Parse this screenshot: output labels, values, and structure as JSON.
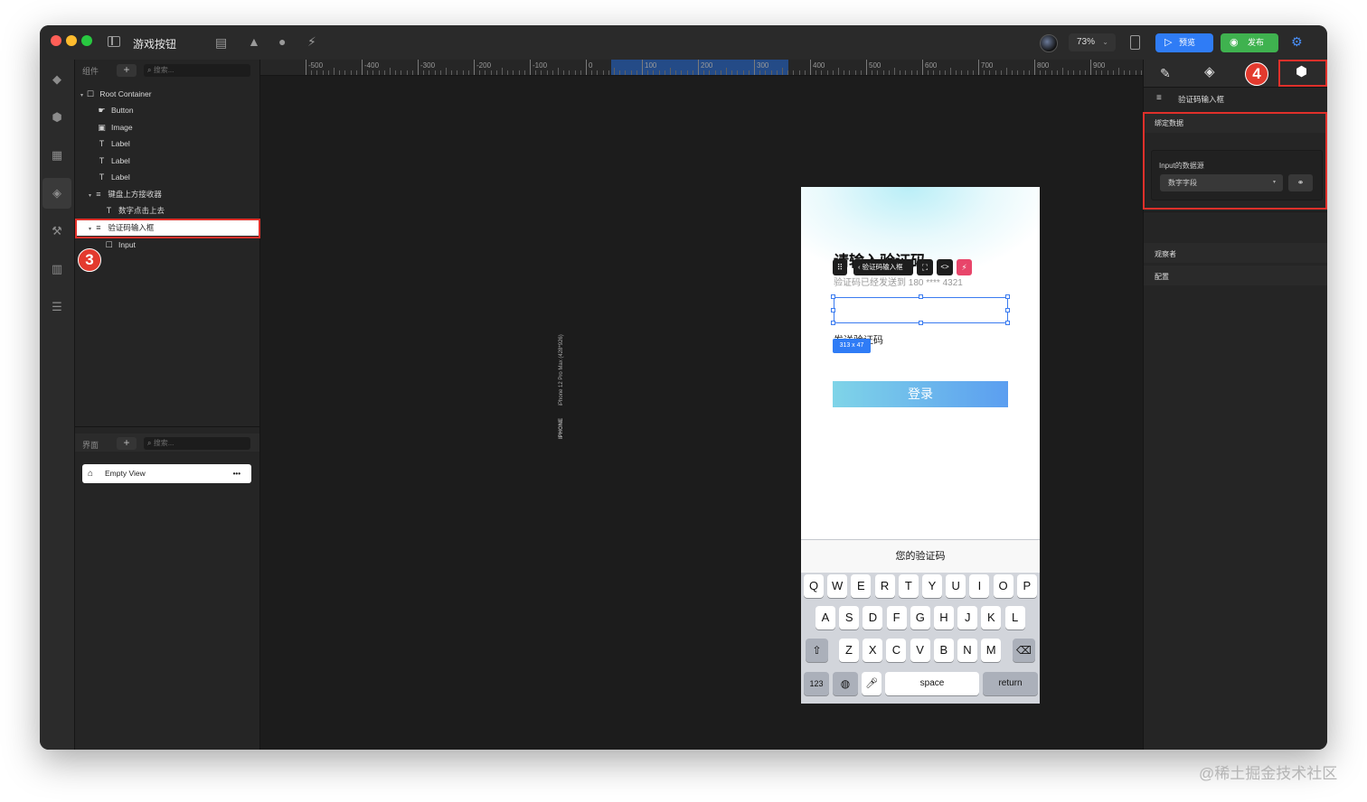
{
  "window": {
    "title": "游戏按钮",
    "zoom": "73%",
    "preview_label": "预览",
    "publish_label": "发布"
  },
  "components_panel": {
    "title": "组件",
    "search_placeholder": "搜索...",
    "tree": [
      {
        "label": "Root Container",
        "icon": "square-icon"
      },
      {
        "label": "Button",
        "icon": "hand-pointer-icon"
      },
      {
        "label": "Image",
        "icon": "image-icon"
      },
      {
        "label": "Label",
        "icon": "text-icon"
      },
      {
        "label": "Label",
        "icon": "text-icon"
      },
      {
        "label": "Label",
        "icon": "text-icon"
      },
      {
        "label": "键盘上方接收器",
        "icon": "database-icon"
      },
      {
        "label": "数字点击上去",
        "icon": "text-icon"
      },
      {
        "label": "验证码输入框",
        "icon": "database-icon"
      },
      {
        "label": "Input",
        "icon": "square-icon"
      }
    ]
  },
  "screens_panel": {
    "title": "界面",
    "search_placeholder": "搜索...",
    "items": [
      {
        "label": "Empty View",
        "more": "•••"
      }
    ]
  },
  "ruler": {
    "ticks": [
      "-500",
      "-400",
      "-300",
      "-200",
      "-100",
      "0",
      "100",
      "200",
      "300",
      "400",
      "500",
      "600",
      "700",
      "800",
      "900"
    ]
  },
  "device_label": {
    "name": "IPHONE",
    "model": "iPhone 12 Pro Max (428*926)"
  },
  "phone": {
    "title": "请输入验证码",
    "subtitle": "验证码已经发送到 180 **** 4321",
    "send_code": "发送验证码",
    "size_badge": "313 x 47",
    "toolbar_label": "验证码输入框",
    "login_button": "登录",
    "keyboard_header": "您的验证码",
    "row1": [
      "Q",
      "W",
      "E",
      "R",
      "T",
      "Y",
      "U",
      "I",
      "O",
      "P"
    ],
    "row2": [
      "A",
      "S",
      "D",
      "F",
      "G",
      "H",
      "J",
      "K",
      "L"
    ],
    "row3": [
      "Z",
      "X",
      "C",
      "V",
      "B",
      "N",
      "M"
    ],
    "key_123": "123",
    "key_space": "space",
    "key_return": "return"
  },
  "right_panel": {
    "component_name": "验证码输入框",
    "binding_section": "绑定数据",
    "datasource_label": "Input的数据源",
    "datasource_value": "数字字段",
    "observers_section": "观察者",
    "config_section": "配置"
  },
  "annotations": {
    "badge3": "3",
    "badge4": "4"
  },
  "watermark": "@稀土掘金技术社区",
  "colors": {
    "accent_blue": "#2f7cf6",
    "publish_green": "#3fb24f",
    "annotation_red": "#e0302a",
    "login_gradient_start": "#7fd4e8",
    "login_gradient_end": "#5b9ef0"
  }
}
